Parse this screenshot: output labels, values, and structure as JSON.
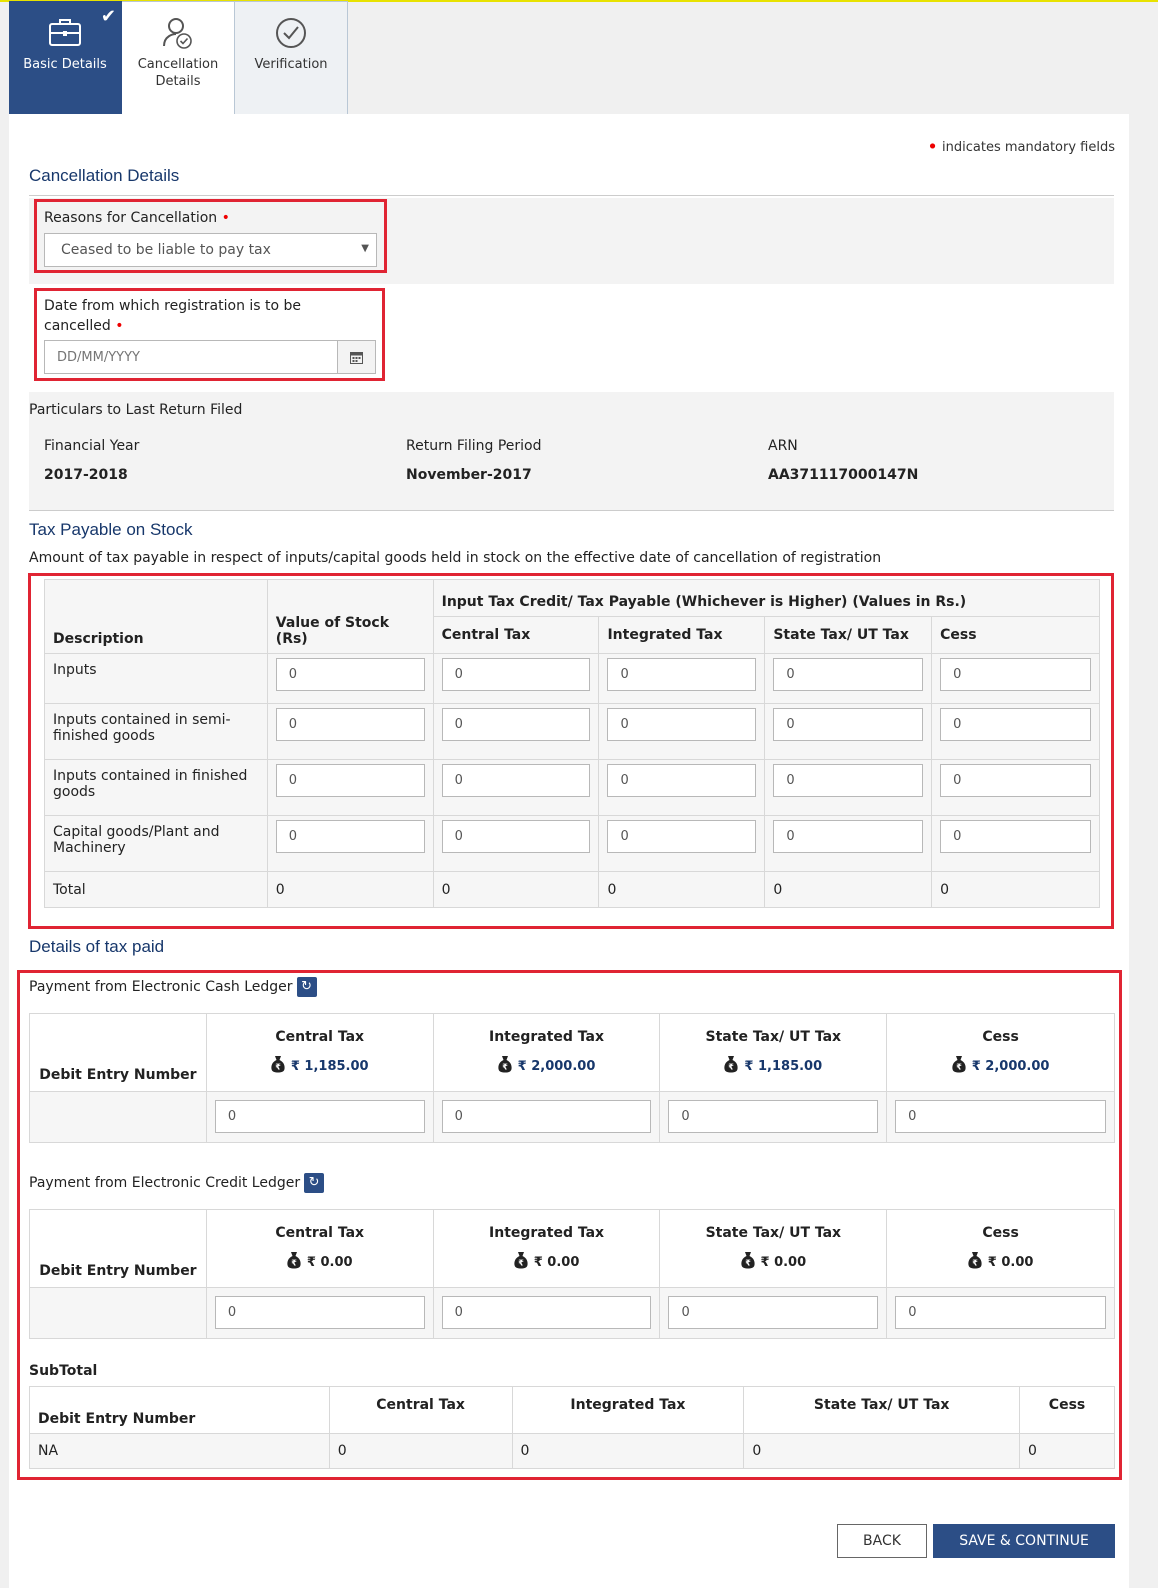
{
  "tabs": [
    {
      "label": "Basic Details",
      "icon": "briefcase-icon",
      "active": true
    },
    {
      "label": "Cancellation Details",
      "icon": "user-check-icon",
      "active": false
    },
    {
      "label": "Verification",
      "icon": "check-circle-icon",
      "active": false
    }
  ],
  "mandatory_note": "indicates mandatory fields",
  "cancellation": {
    "title": "Cancellation Details",
    "reason_label": "Reasons for Cancellation",
    "reason_value": "Ceased to be liable to pay tax",
    "date_label": "Date from which registration is to be cancelled",
    "date_placeholder": "DD/MM/YYYY"
  },
  "last_return": {
    "title": "Particulars to Last Return Filed",
    "fy_label": "Financial Year",
    "fy_value": "2017-2018",
    "period_label": "Return Filing Period",
    "period_value": "November-2017",
    "arn_label": "ARN",
    "arn_value": "AA371117000147N"
  },
  "stock": {
    "title": "Tax Payable on Stock",
    "subtitle": "Amount of tax payable in respect of inputs/capital goods held in stock on the effective date of cancellation of registration",
    "headers": {
      "description": "Description",
      "value": "Value of Stock (Rs)",
      "group": "Input Tax Credit/ Tax Payable (Whichever is Higher) (Values in Rs.)",
      "central": "Central Tax",
      "integrated": "Integrated Tax",
      "state": "State Tax/ UT Tax",
      "cess": "Cess"
    },
    "rows": [
      {
        "label": "Inputs",
        "values": [
          "0",
          "0",
          "0",
          "0",
          "0"
        ]
      },
      {
        "label": "Inputs contained in semi-finished goods",
        "values": [
          "0",
          "0",
          "0",
          "0",
          "0"
        ]
      },
      {
        "label": "Inputs contained in finished goods",
        "values": [
          "0",
          "0",
          "0",
          "0",
          "0"
        ]
      },
      {
        "label": "Capital goods/Plant and Machinery",
        "values": [
          "0",
          "0",
          "0",
          "0",
          "0"
        ]
      }
    ],
    "total": {
      "label": "Total",
      "values": [
        "0",
        "0",
        "0",
        "0",
        "0"
      ]
    }
  },
  "tax_paid": {
    "title": "Details of tax paid",
    "cash": {
      "label": "Payment from Electronic Cash Ledger",
      "debit_label": "Debit Entry Number",
      "columns": [
        {
          "name": "Central Tax",
          "amount": "₹ 1,185.00"
        },
        {
          "name": "Integrated Tax",
          "amount": "₹ 2,000.00"
        },
        {
          "name": "State Tax/ UT Tax",
          "amount": "₹ 1,185.00"
        },
        {
          "name": "Cess",
          "amount": "₹ 2,000.00"
        }
      ],
      "inputs": [
        "0",
        "0",
        "0",
        "0"
      ]
    },
    "credit": {
      "label": "Payment from Electronic Credit Ledger",
      "debit_label": "Debit Entry Number",
      "columns": [
        {
          "name": "Central Tax",
          "amount": "₹ 0.00"
        },
        {
          "name": "Integrated Tax",
          "amount": "₹ 0.00"
        },
        {
          "name": "State Tax/ UT Tax",
          "amount": "₹ 0.00"
        },
        {
          "name": "Cess",
          "amount": "₹ 0.00"
        }
      ],
      "inputs": [
        "0",
        "0",
        "0",
        "0"
      ]
    },
    "subtotal": {
      "label": "SubTotal",
      "debit_label": "Debit Entry Number",
      "columns": [
        "Central Tax",
        "Integrated Tax",
        "State Tax/ UT Tax",
        "Cess"
      ],
      "row": [
        "NA",
        "0",
        "0",
        "0",
        "0"
      ]
    }
  },
  "buttons": {
    "back": "BACK",
    "save": "SAVE & CONTINUE"
  }
}
